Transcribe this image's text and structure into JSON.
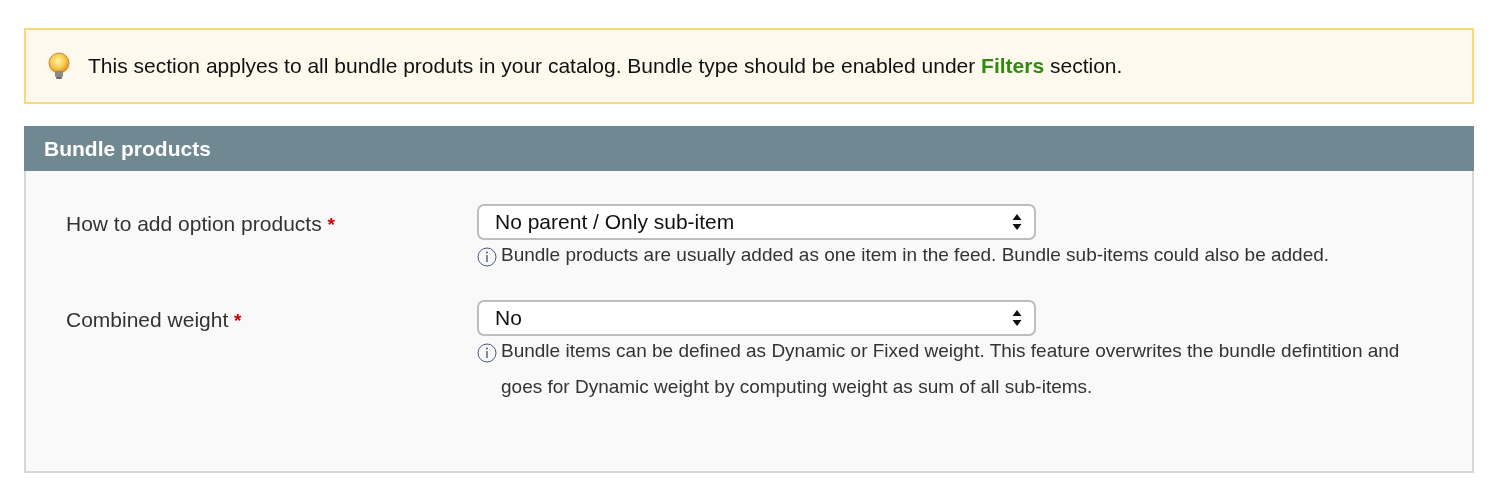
{
  "notice": {
    "text": "This section applyes to all bundle produts in your catalog. Bundle type should be enabled under **Filters** section."
  },
  "section": {
    "title": "Bundle products",
    "fields": [
      {
        "label": "How to add option products",
        "required_mark": "*",
        "value": "No parent / Only sub-item",
        "hint": "Bundle products are usually added as one item in the feed. Bundle sub-items could also be added."
      },
      {
        "label": "Combined weight",
        "required_mark": "*",
        "value": "No",
        "hint": "Bundle items can be defined as Dynamic or Fixed weight. This feature overwrites the bundle defintition and goes for Dynamic weight by computing weight as sum of all sub-items."
      }
    ]
  }
}
